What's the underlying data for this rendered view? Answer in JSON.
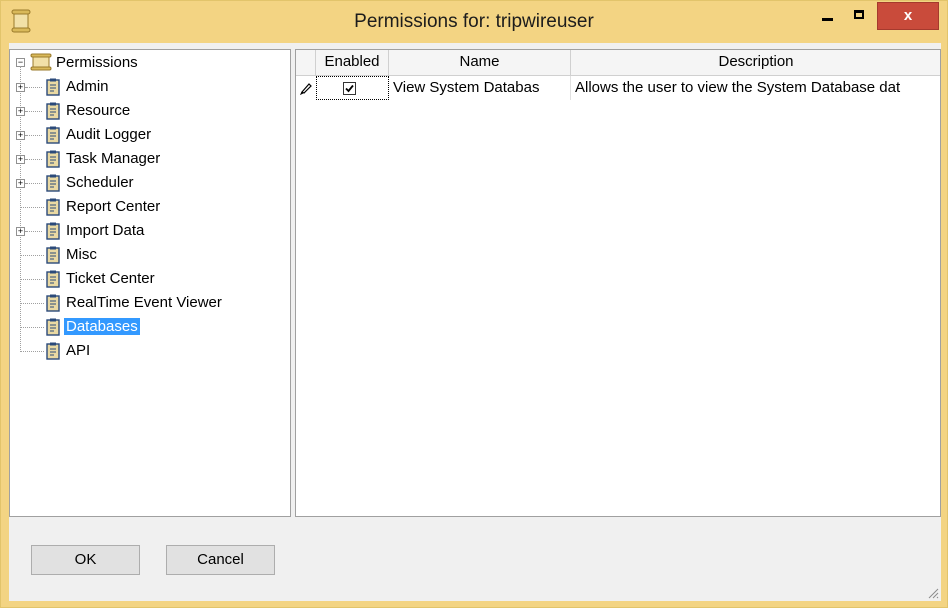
{
  "window": {
    "title": "Permissions for: tripwireuser"
  },
  "title_controls": {
    "minimize": "minimize",
    "maximize": "maximize",
    "close": "x"
  },
  "tree": {
    "root": "Permissions",
    "items": [
      {
        "label": "Admin",
        "expandable": true
      },
      {
        "label": "Resource",
        "expandable": true
      },
      {
        "label": "Audit Logger",
        "expandable": true
      },
      {
        "label": "Task Manager",
        "expandable": true
      },
      {
        "label": "Scheduler",
        "expandable": true
      },
      {
        "label": "Report Center",
        "expandable": false
      },
      {
        "label": "Import Data",
        "expandable": true
      },
      {
        "label": "Misc",
        "expandable": false
      },
      {
        "label": "Ticket Center",
        "expandable": false
      },
      {
        "label": "RealTime Event Viewer",
        "expandable": false
      },
      {
        "label": "Databases",
        "expandable": false,
        "selected": true
      },
      {
        "label": "API",
        "expandable": false
      }
    ]
  },
  "grid": {
    "columns": [
      "Enabled",
      "Name",
      "Description"
    ],
    "rows": [
      {
        "enabled": true,
        "name": "View System Databas",
        "description": "Allows the user to view the System Database dat"
      }
    ]
  },
  "buttons": {
    "ok": "OK",
    "cancel": "Cancel"
  },
  "icons": {
    "app": "scroll-icon",
    "tree_root": "scroll-icon",
    "tree_item": "clipboard-icon",
    "row_editing": "pencil-icon",
    "check": "checkmark-icon",
    "resize": "size-grip-icon"
  },
  "colors": {
    "title_bar": "#f3d483",
    "close_button": "#c94b3b",
    "selection": "#3399ff"
  }
}
